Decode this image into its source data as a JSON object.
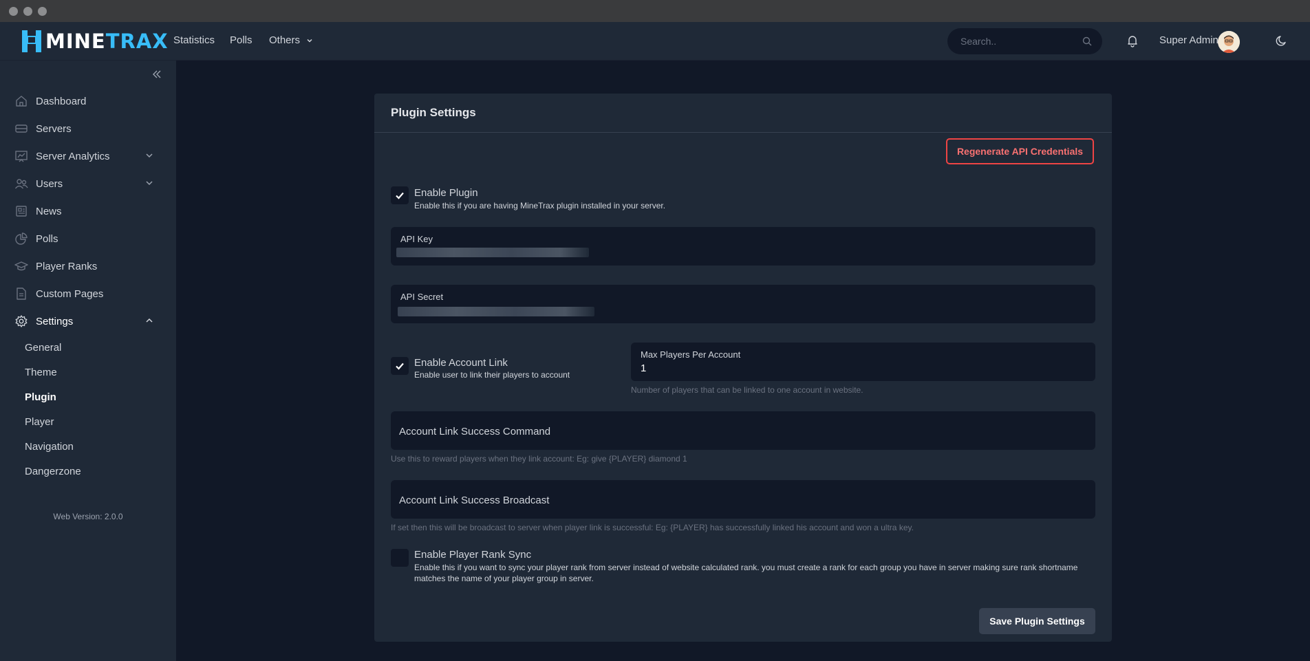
{
  "app": {
    "logo_white": "MINE",
    "logo_blue": "TRAX"
  },
  "topnav": {
    "links": [
      "Statistics",
      "Polls",
      "Others"
    ],
    "search_placeholder": "Search..",
    "user_name": "Super Admin"
  },
  "sidebar": {
    "items": [
      "Dashboard",
      "Servers",
      "Server Analytics",
      "Users",
      "News",
      "Polls",
      "Player Ranks",
      "Custom Pages",
      "Settings"
    ],
    "settings_sub": [
      "General",
      "Theme",
      "Plugin",
      "Player",
      "Navigation",
      "Dangerzone"
    ],
    "version": "Web Version: 2.0.0"
  },
  "panel": {
    "title": "Plugin Settings",
    "regen_label": "Regenerate API Credentials",
    "enable_plugin": {
      "label": "Enable Plugin",
      "help": "Enable this if you are having MineTrax plugin installed in your server.",
      "checked": true
    },
    "api_key_label": "API Key",
    "api_secret_label": "API Secret",
    "enable_account_link": {
      "label": "Enable Account Link",
      "help": "Enable user to link their players to account",
      "checked": true
    },
    "max_players": {
      "label": "Max Players Per Account",
      "value": "1",
      "help": "Number of players that can be linked to one account in website."
    },
    "link_command": {
      "placeholder": "Account Link Success Command",
      "help": "Use this to reward players when they link account: Eg: give {PLAYER} diamond 1"
    },
    "link_broadcast": {
      "placeholder": "Account Link Success Broadcast",
      "help": "If set then this will be broadcast to server when player link is successful: Eg: {PLAYER} has successfully linked his account and won a ultra key."
    },
    "rank_sync": {
      "label": "Enable Player Rank Sync",
      "help": "Enable this if you want to sync your player rank from server instead of website calculated rank. you must create a rank for each group you have in server making sure rank shortname matches the name of your player group in server.",
      "checked": false
    },
    "save_label": "Save Plugin Settings"
  }
}
